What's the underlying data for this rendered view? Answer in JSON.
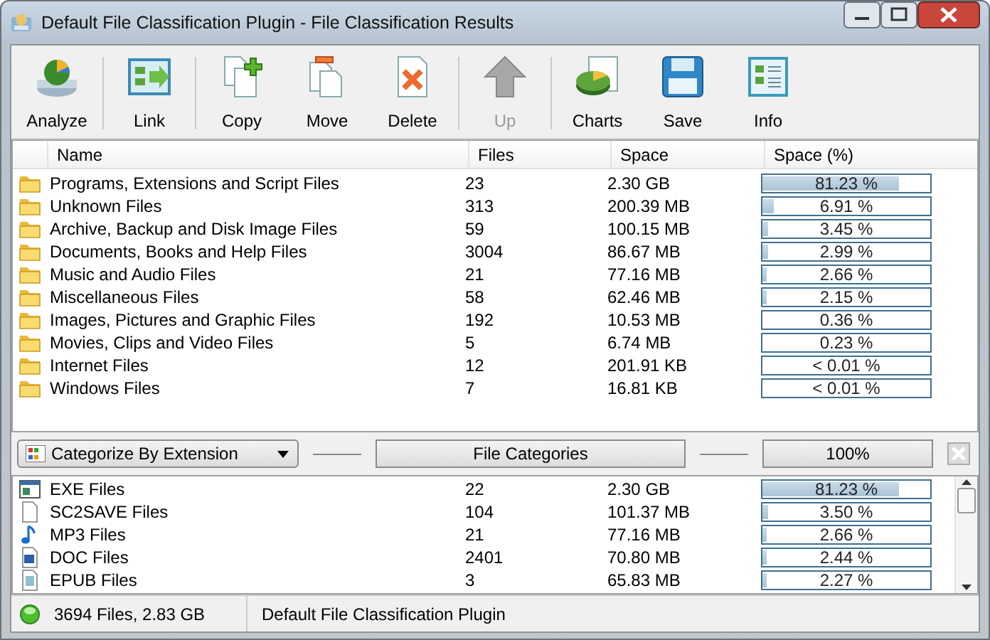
{
  "window": {
    "title": "Default File Classification Plugin - File Classification Results"
  },
  "toolbar": [
    {
      "label": "Analyze",
      "disabled": false
    },
    {
      "label": "Link",
      "disabled": false
    },
    {
      "label": "Copy",
      "disabled": false
    },
    {
      "label": "Move",
      "disabled": false
    },
    {
      "label": "Delete",
      "disabled": false
    },
    {
      "label": "Up",
      "disabled": true
    },
    {
      "label": "Charts",
      "disabled": false
    },
    {
      "label": "Save",
      "disabled": false
    },
    {
      "label": "Info",
      "disabled": false
    }
  ],
  "categories_table": {
    "columns": [
      "Name",
      "Files",
      "Space",
      "Space (%)"
    ],
    "rows": [
      {
        "name": "Programs, Extensions and Script Files",
        "files": "23",
        "space": "2.30 GB",
        "percent": "81.23 %",
        "level": 0.8123
      },
      {
        "name": "Unknown Files",
        "files": "313",
        "space": "200.39 MB",
        "percent": "6.91 %",
        "level": 0.0691
      },
      {
        "name": "Archive, Backup and Disk Image Files",
        "files": "59",
        "space": "100.15 MB",
        "percent": "3.45 %",
        "level": 0.0345
      },
      {
        "name": "Documents, Books and Help Files",
        "files": "3004",
        "space": "86.67 MB",
        "percent": "2.99 %",
        "level": 0.0299
      },
      {
        "name": "Music and Audio Files",
        "files": "21",
        "space": "77.16 MB",
        "percent": "2.66 %",
        "level": 0.0266
      },
      {
        "name": "Miscellaneous Files",
        "files": "58",
        "space": "62.46 MB",
        "percent": "2.15 %",
        "level": 0.0215
      },
      {
        "name": "Images, Pictures and Graphic Files",
        "files": "192",
        "space": "10.53 MB",
        "percent": "0.36 %",
        "level": 0.0036
      },
      {
        "name": "Movies, Clips and Video Files",
        "files": "5",
        "space": "6.74 MB",
        "percent": "0.23 %",
        "level": 0.0023
      },
      {
        "name": "Internet Files",
        "files": "12",
        "space": "201.91 KB",
        "percent": "< 0.01 %",
        "level": 0.0
      },
      {
        "name": "Windows Files",
        "files": "7",
        "space": "16.81 KB",
        "percent": "< 0.01 %",
        "level": 0.0
      }
    ]
  },
  "middle_bar": {
    "dropdown": "Categorize By Extension",
    "button": "File Categories",
    "zoom": "100%"
  },
  "extensions_table": {
    "rows": [
      {
        "kind": "exe",
        "name": "EXE Files",
        "files": "22",
        "space": "2.30 GB",
        "percent": "81.23 %",
        "level": 0.8123
      },
      {
        "kind": "blank",
        "name": "SC2SAVE Files",
        "files": "104",
        "space": "101.37 MB",
        "percent": "3.50 %",
        "level": 0.035
      },
      {
        "kind": "music",
        "name": "MP3 Files",
        "files": "21",
        "space": "77.16 MB",
        "percent": "2.66 %",
        "level": 0.0266
      },
      {
        "kind": "doc",
        "name": "DOC Files",
        "files": "2401",
        "space": "70.80 MB",
        "percent": "2.44 %",
        "level": 0.0244
      },
      {
        "kind": "epub",
        "name": "EPUB Files",
        "files": "3",
        "space": "65.83 MB",
        "percent": "2.27 %",
        "level": 0.0227
      }
    ]
  },
  "status_bar": {
    "summary": "3694 Files, 2.83 GB",
    "plugin": "Default File Classification Plugin"
  }
}
